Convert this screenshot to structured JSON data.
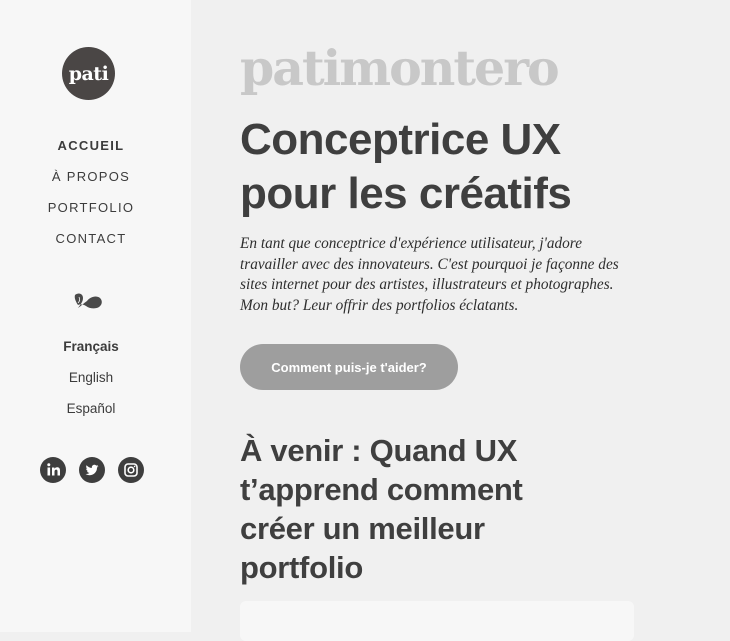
{
  "sidebar": {
    "logo_text": "pati",
    "nav": [
      {
        "label": "ACCUEIL",
        "active": true
      },
      {
        "label": "À PROPOS",
        "active": false
      },
      {
        "label": "PORTFOLIO",
        "active": false
      },
      {
        "label": "CONTACT",
        "active": false
      }
    ],
    "languages": [
      {
        "label": "Français",
        "active": true
      },
      {
        "label": "English",
        "active": false
      },
      {
        "label": "Español",
        "active": false
      }
    ],
    "social_icons": [
      "linkedin-icon",
      "twitter-icon",
      "instagram-icon"
    ]
  },
  "main": {
    "wordmark": "patimontero",
    "headline_line1": "Conceptrice UX",
    "headline_line2": "pour les créatifs",
    "intro": "En tant que conceptrice d'expérience utilisateur, j'adore travailler avec des innovateurs. C'est pourquoi je façonne des sites internet pour des artistes, illustrateurs et photographes. Mon but? Leur offrir des portfolios éclatants.",
    "cta_label": "Comment puis-je t'aider?",
    "post_title": "À venir : Quand UX t’apprend comment créer un meilleur portfolio"
  },
  "colors": {
    "sidebar_bg": "#f7f7f7",
    "main_bg": "#f0f0f0",
    "logo_bg": "#4a4645",
    "text_dark": "#3f3f3f",
    "wordmark": "#c8c8c8",
    "cta_bg": "#9e9e9e"
  }
}
